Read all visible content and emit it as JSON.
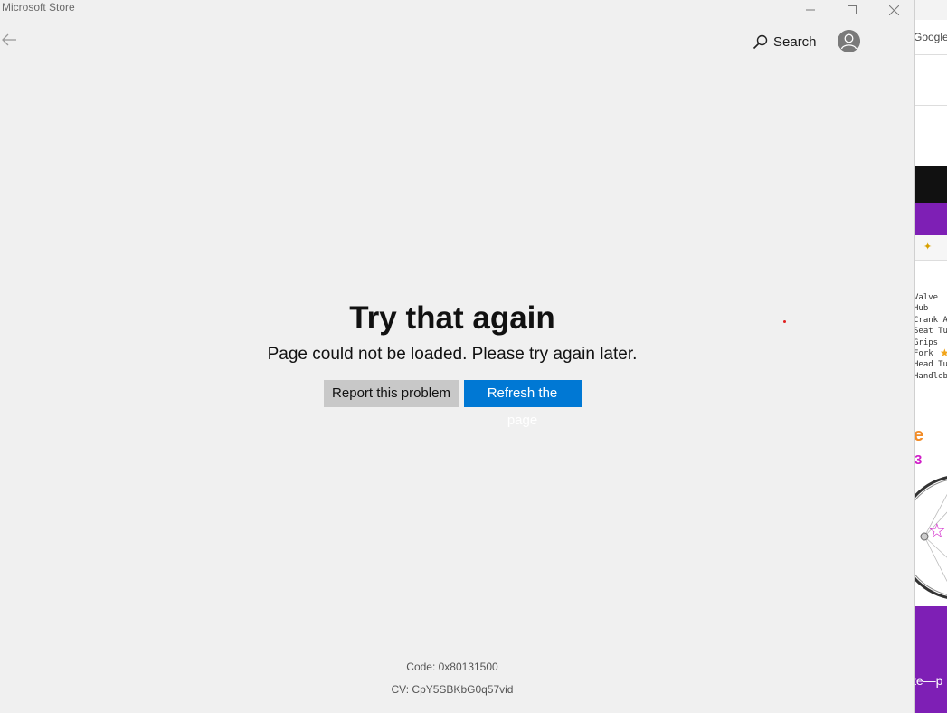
{
  "app": {
    "title": "Microsoft Store"
  },
  "window_controls": {
    "minimize": "minimize-icon",
    "maximize": "maximize-icon",
    "close": "close-icon"
  },
  "nav": {
    "back_icon": "arrow-left-icon",
    "search_label": "Search",
    "search_icon": "search-icon",
    "account_icon": "account-icon"
  },
  "error": {
    "title": "Try that again",
    "message": "Page could not be loaded. Please try again later.",
    "report_button": "Report this problem",
    "refresh_button": "Refresh the page",
    "code": "Code: 0x80131500",
    "cv": "CV: CpY5SBKbG0q57vid"
  },
  "background_window": {
    "google_text": "Google",
    "parts_list": "Valve\nHub\nCrank A\nSeat Tu\nGrips\nFork\nHead Tu\nHandleb",
    "footer_text": "te—p",
    "colors": {
      "black_bar": "#111111",
      "purple": "#7e1fb5",
      "orange": "#f28c28",
      "magenta": "#d020c8"
    }
  },
  "colors": {
    "accent": "#0078d4",
    "window_bg": "#f0f0f0",
    "secondary_button": "#c8c8c8"
  }
}
